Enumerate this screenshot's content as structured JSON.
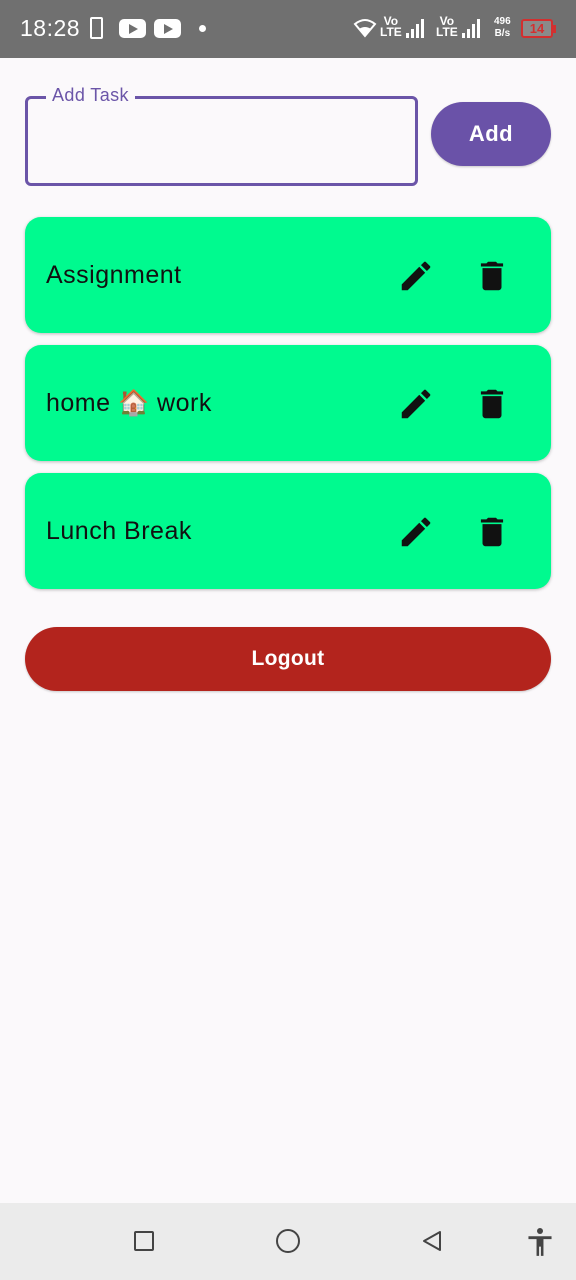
{
  "status_bar": {
    "time": "18:28",
    "lte1_top": "Vo",
    "lte1_bottom": "LTE",
    "lte2_top": "Vo",
    "lte2_bottom": "LTE",
    "speed_value": "496",
    "speed_unit": "B/s",
    "battery": "14",
    "icons": [
      "phone-outline-icon",
      "youtube-icon",
      "youtube-icon",
      "dot-icon",
      "wifi-icon",
      "signal-icon",
      "signal-icon",
      "battery-icon"
    ]
  },
  "task_input": {
    "label": "Add Task",
    "value": "",
    "placeholder": ""
  },
  "add_button": {
    "label": "Add"
  },
  "tasks": [
    {
      "text": "Assignment",
      "edit_icon": "pencil-icon",
      "delete_icon": "trash-icon"
    },
    {
      "text": "home 🏠 work",
      "edit_icon": "pencil-icon",
      "delete_icon": "trash-icon"
    },
    {
      "text": "Lunch Break",
      "edit_icon": "pencil-icon",
      "delete_icon": "trash-icon"
    }
  ],
  "logout_button": {
    "label": "Logout"
  },
  "nav_bar": {
    "icons": [
      "recents-square-icon",
      "home-circle-icon",
      "back-triangle-icon",
      "accessibility-icon"
    ]
  },
  "colors": {
    "accent": "#6a52a8",
    "card": "#00fa8f",
    "logout": "#b3241d",
    "background": "#fbf9fb"
  }
}
